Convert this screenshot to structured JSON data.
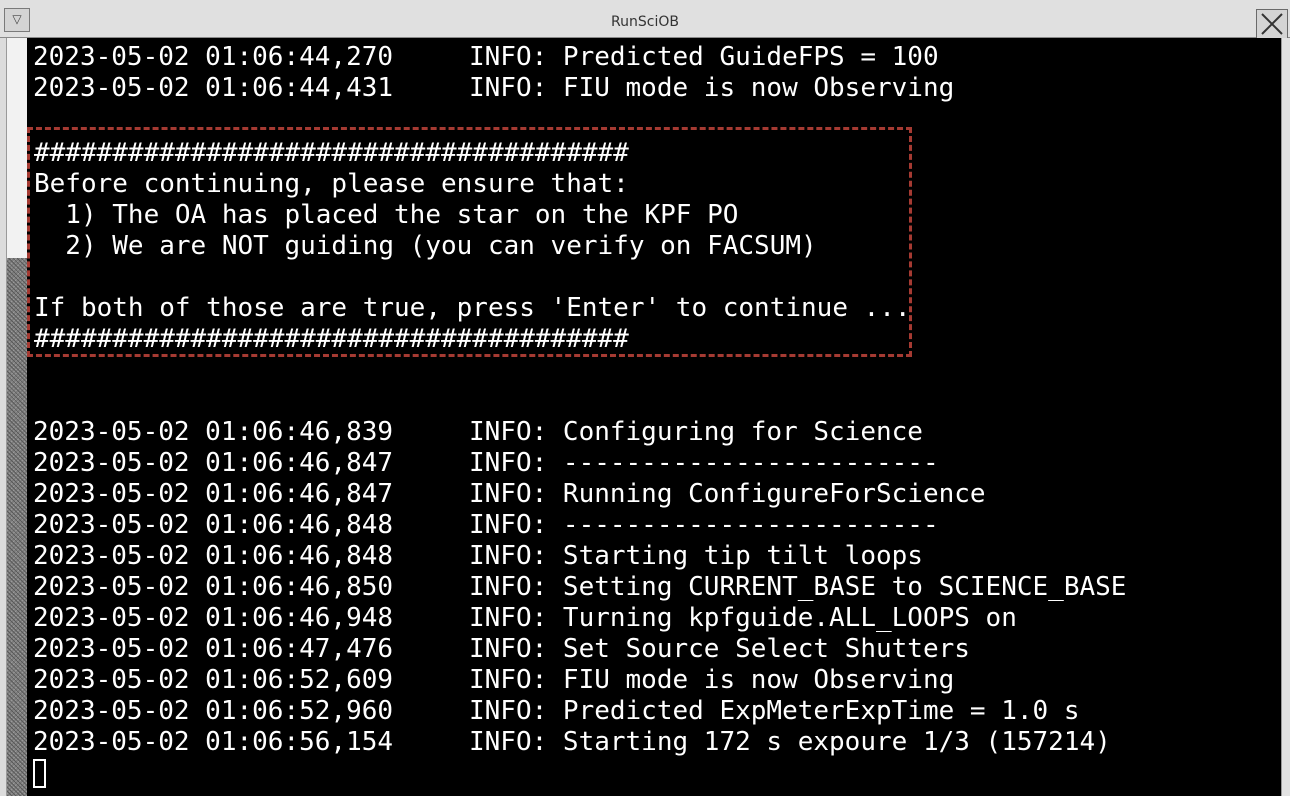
{
  "window": {
    "title": "RunSciOB",
    "menu_glyph": "▽"
  },
  "log_top": [
    {
      "timestamp": "2023-05-02 01:06:44,270",
      "message": "INFO: Predicted GuideFPS = 100"
    },
    {
      "timestamp": "2023-05-02 01:06:44,431",
      "message": "INFO: FIU mode is now Observing"
    }
  ],
  "prompt": {
    "border_color": "#a53a32",
    "lines": [
      "######################################",
      "Before continuing, please ensure that:",
      "  1) The OA has placed the star on the KPF PO",
      "  2) We are NOT guiding (you can verify on FACSUM)",
      "",
      "If both of those are true, press 'Enter' to continue ...",
      "######################################"
    ]
  },
  "log_bottom": [
    {
      "timestamp": "2023-05-02 01:06:46,839",
      "message": "INFO: Configuring for Science"
    },
    {
      "timestamp": "2023-05-02 01:06:46,847",
      "message": "INFO: ------------------------"
    },
    {
      "timestamp": "2023-05-02 01:06:46,847",
      "message": "INFO: Running ConfigureForScience"
    },
    {
      "timestamp": "2023-05-02 01:06:46,848",
      "message": "INFO: ------------------------"
    },
    {
      "timestamp": "2023-05-02 01:06:46,848",
      "message": "INFO: Starting tip tilt loops"
    },
    {
      "timestamp": "2023-05-02 01:06:46,850",
      "message": "INFO: Setting CURRENT_BASE to SCIENCE_BASE"
    },
    {
      "timestamp": "2023-05-02 01:06:46,948",
      "message": "INFO: Turning kpfguide.ALL_LOOPS on"
    },
    {
      "timestamp": "2023-05-02 01:06:47,476",
      "message": "INFO: Set Source Select Shutters"
    },
    {
      "timestamp": "2023-05-02 01:06:52,609",
      "message": "INFO: FIU mode is now Observing"
    },
    {
      "timestamp": "2023-05-02 01:06:52,960",
      "message": "INFO: Predicted ExpMeterExpTime = 1.0 s"
    },
    {
      "timestamp": "2023-05-02 01:06:56,154",
      "message": "INFO: Starting 172 s expoure 1/3 (157214)"
    }
  ],
  "colors": {
    "terminal_bg": "#000000",
    "terminal_fg": "#ffffff",
    "prompt_border": "#a53a32"
  }
}
